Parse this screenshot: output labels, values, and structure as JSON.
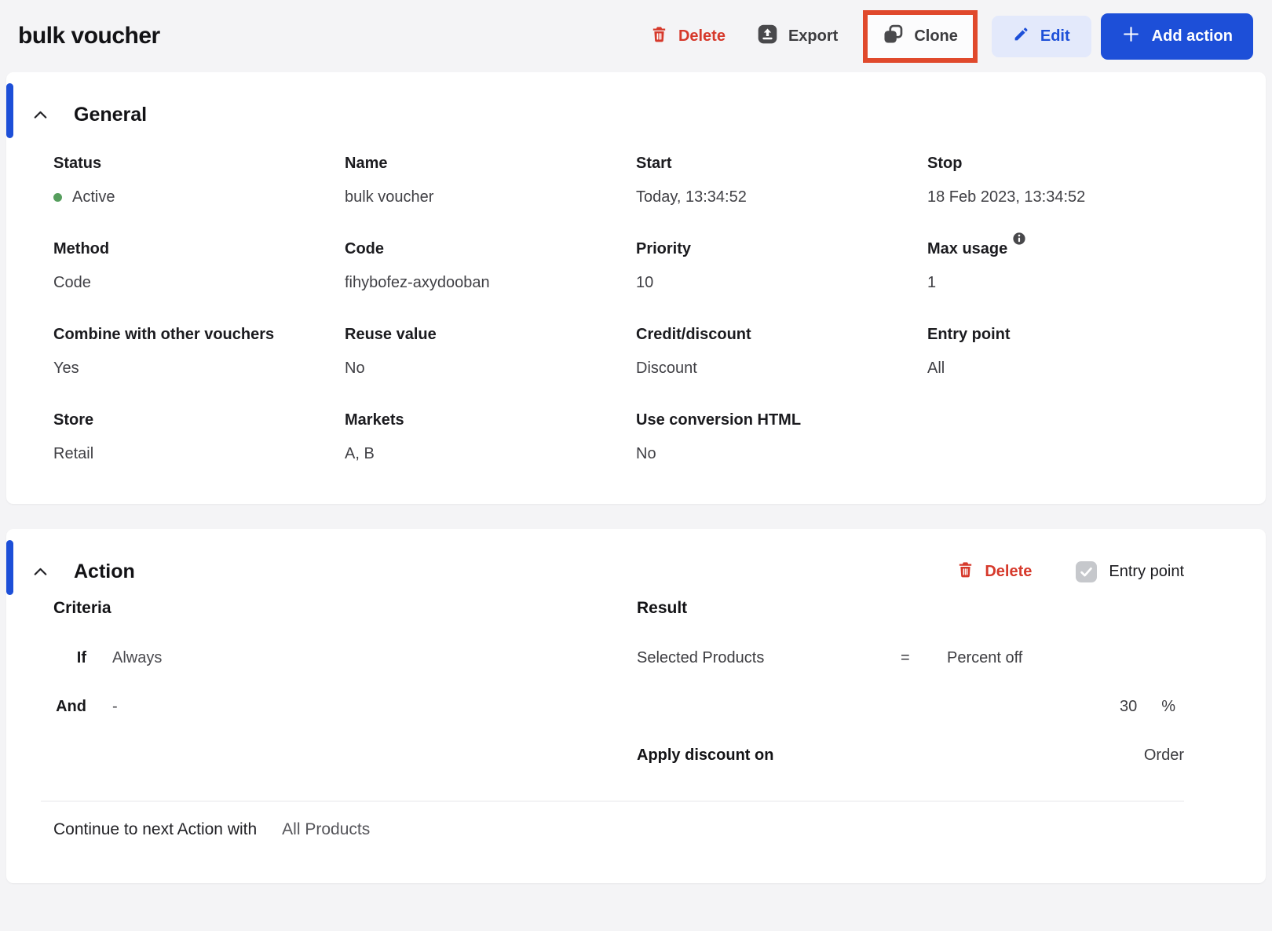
{
  "header": {
    "title": "bulk voucher",
    "delete_label": "Delete",
    "export_label": "Export",
    "clone_label": "Clone",
    "edit_label": "Edit",
    "add_action_label": "Add action"
  },
  "colors": {
    "accent_blue": "#1d4fd8",
    "edit_button_bg": "#e3e9fb",
    "danger_red": "#d6392b",
    "annotation_box_red": "#e0492c",
    "status_green": "#569e5d",
    "page_bg": "#f4f4f6"
  },
  "general": {
    "title": "General",
    "fields": [
      {
        "label": "Status",
        "value": "Active"
      },
      {
        "label": "Name",
        "value": "bulk voucher"
      },
      {
        "label": "Start",
        "value": "Today, 13:34:52"
      },
      {
        "label": "Stop",
        "value": "18 Feb 2023, 13:34:52"
      },
      {
        "label": "Method",
        "value": "Code"
      },
      {
        "label": "Code",
        "value": "fihybofez-axydooban"
      },
      {
        "label": "Priority",
        "value": "10"
      },
      {
        "label": "Max usage",
        "value": "1"
      },
      {
        "label": "Combine with other vouchers",
        "value": "Yes"
      },
      {
        "label": "Reuse value",
        "value": "No"
      },
      {
        "label": "Credit/discount",
        "value": "Discount"
      },
      {
        "label": "Entry point",
        "value": "All"
      },
      {
        "label": "Store",
        "value": "Retail"
      },
      {
        "label": "Markets",
        "value": "A, B"
      },
      {
        "label": "Use conversion HTML",
        "value": "No"
      }
    ]
  },
  "action": {
    "title": "Action",
    "delete_label": "Delete",
    "entry_point_label": "Entry point",
    "entry_point_checked": true,
    "criteria": {
      "title": "Criteria",
      "rows": [
        {
          "label": "If",
          "value": "Always"
        },
        {
          "label": "And",
          "value": "-"
        }
      ]
    },
    "result": {
      "title": "Result",
      "row1": {
        "left": "Selected Products",
        "op": "=",
        "right": "Percent off"
      },
      "row2": {
        "value": "30",
        "unit": "%"
      },
      "row3": {
        "label": "Apply discount on",
        "value": "Order"
      }
    },
    "footer": {
      "label": "Continue to next Action with",
      "value": "All Products"
    }
  }
}
